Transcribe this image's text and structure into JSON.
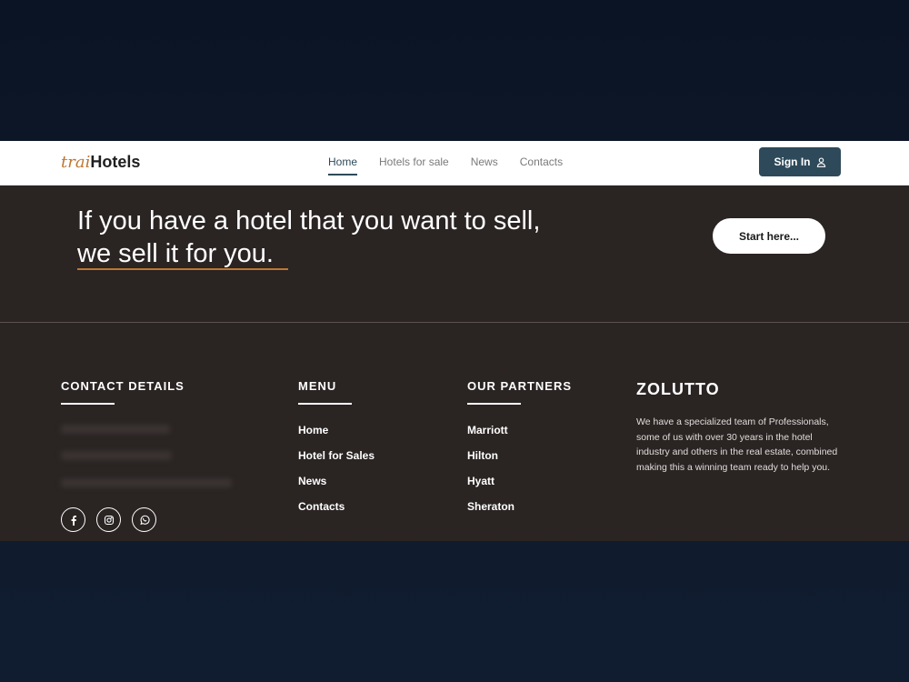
{
  "nav": {
    "logo_prefix": "trai",
    "logo_main": "Hotels",
    "links": [
      {
        "label": "Home"
      },
      {
        "label": "Hotels for sale"
      },
      {
        "label": "News"
      },
      {
        "label": "Contacts"
      }
    ],
    "signin_label": "Sign In"
  },
  "hero": {
    "line1": "If you have a hotel that you want to sell,",
    "line2": "we sell it for you.",
    "cta_label": "Start here..."
  },
  "footer": {
    "contact_heading": "CONTACT DETAILS",
    "menu_heading": "MENU",
    "menu_items": [
      "Home",
      "Hotel for Sales",
      "News",
      "Contacts"
    ],
    "partners_heading": "OUR PARTNERS",
    "partners": [
      "Marriott",
      "Hilton",
      "Hyatt",
      "Sheraton"
    ],
    "brand": "ZOLUTTO",
    "about": "We have a specialized team of Professionals, some of us with over 30 years in the hotel industry and others in the real estate, combined making this a winning team ready to help you.",
    "socials": [
      "facebook-icon",
      "instagram-icon",
      "whatsapp-icon"
    ]
  },
  "colors": {
    "accent": "#c0762f",
    "primary": "#2e4a5a",
    "dark_bg": "#2a2423"
  }
}
